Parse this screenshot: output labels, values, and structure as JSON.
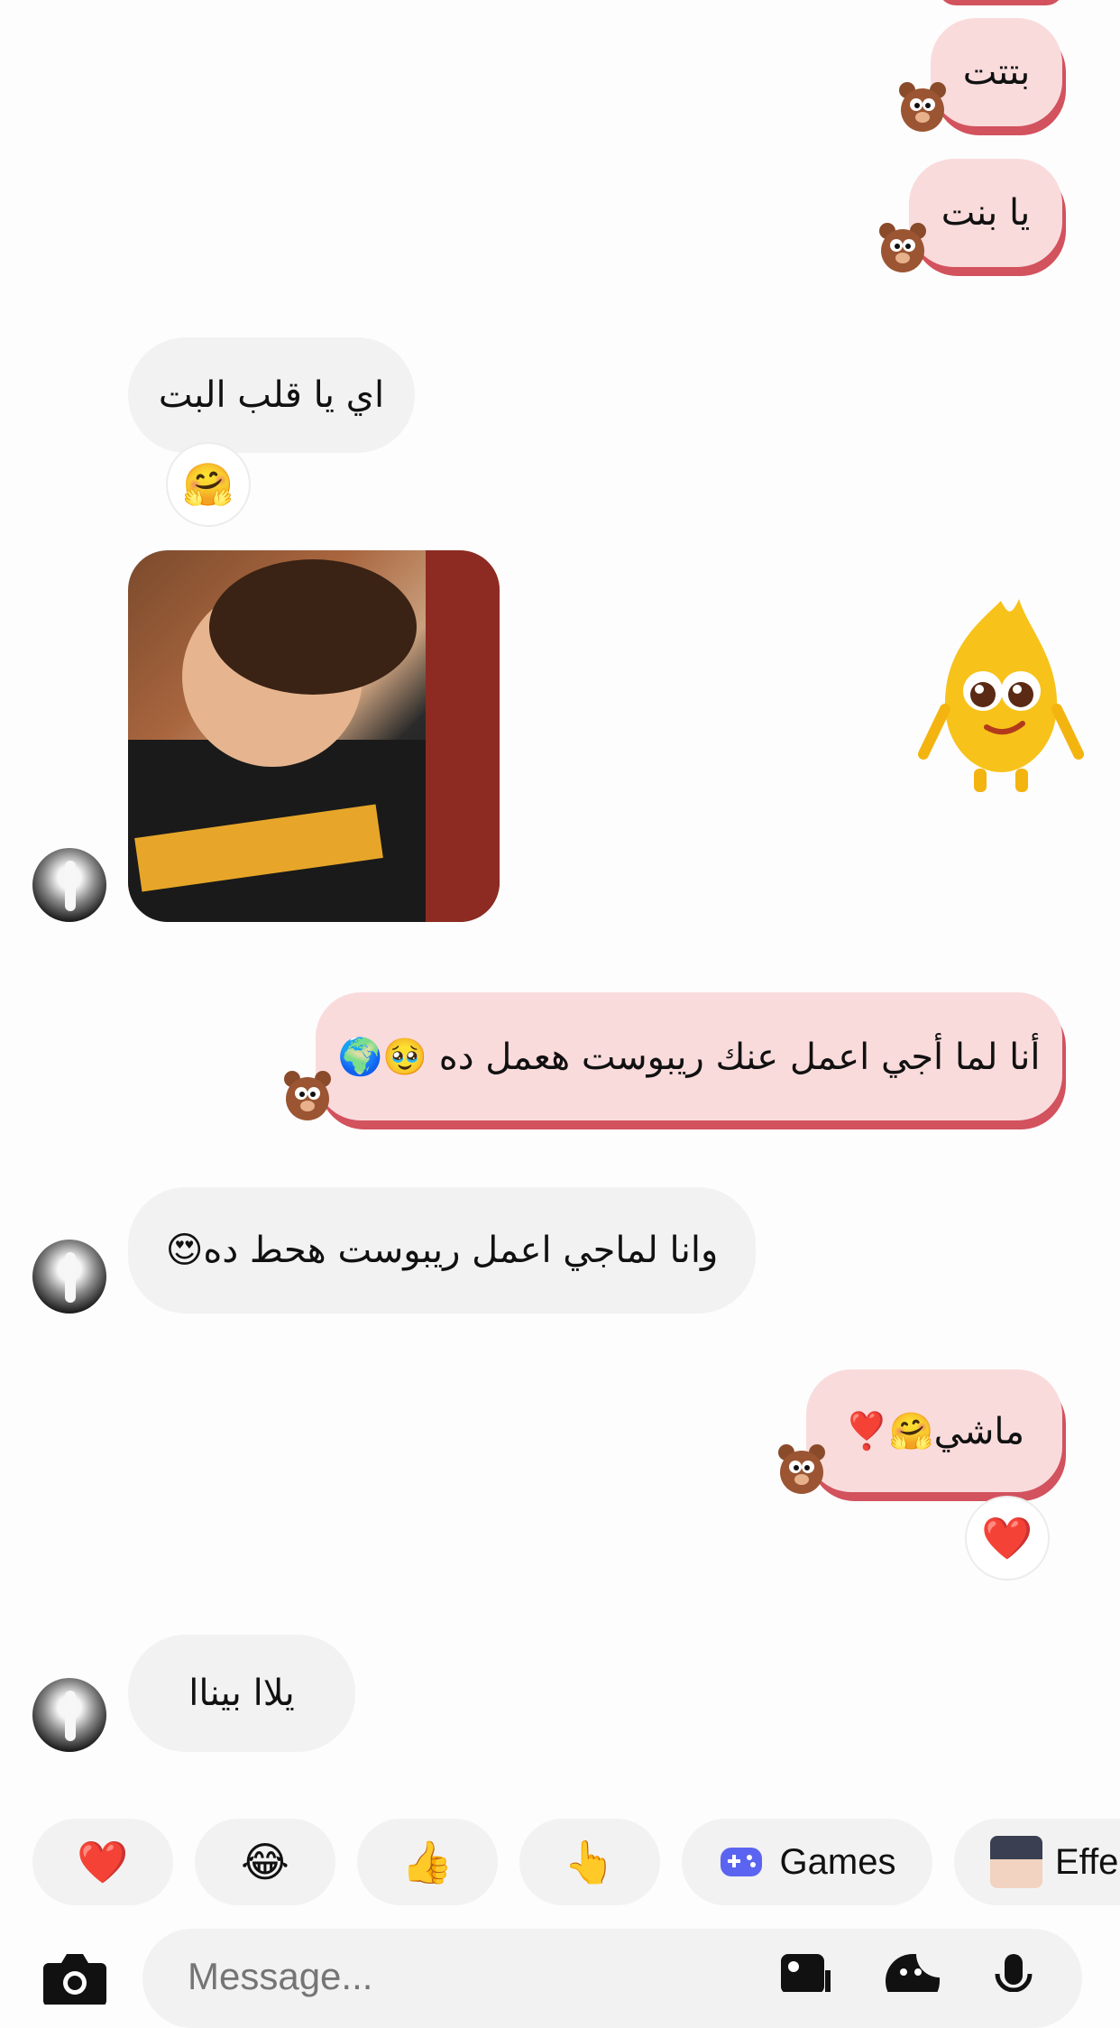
{
  "messages": {
    "out1": "بتتت",
    "out2": "يا بنت",
    "in1": "اي يا قلب البت",
    "in1_reaction": "🤗",
    "out3": "أنا لما أجي اعمل عنك ريبوست هعمل ده 🥹🌍",
    "in2": "وانا لماجي اعمل ريبوست هحط ده😍",
    "out4": "ماشي🤗❣️",
    "out4_reaction": "❤️",
    "in3": "يلاا بيناا"
  },
  "quick_replies": {
    "heart": "❤️",
    "laugh": "😂",
    "thumbs": "👍",
    "point": "👆",
    "games": "Games",
    "effects": "Effe"
  },
  "composer": {
    "placeholder": "Message..."
  },
  "colors": {
    "outgoing_bubble": "#fadbdc",
    "outgoing_accent": "#d2525e",
    "incoming_bubble": "#f2f2f2",
    "games_icon": "#5b64f0"
  }
}
